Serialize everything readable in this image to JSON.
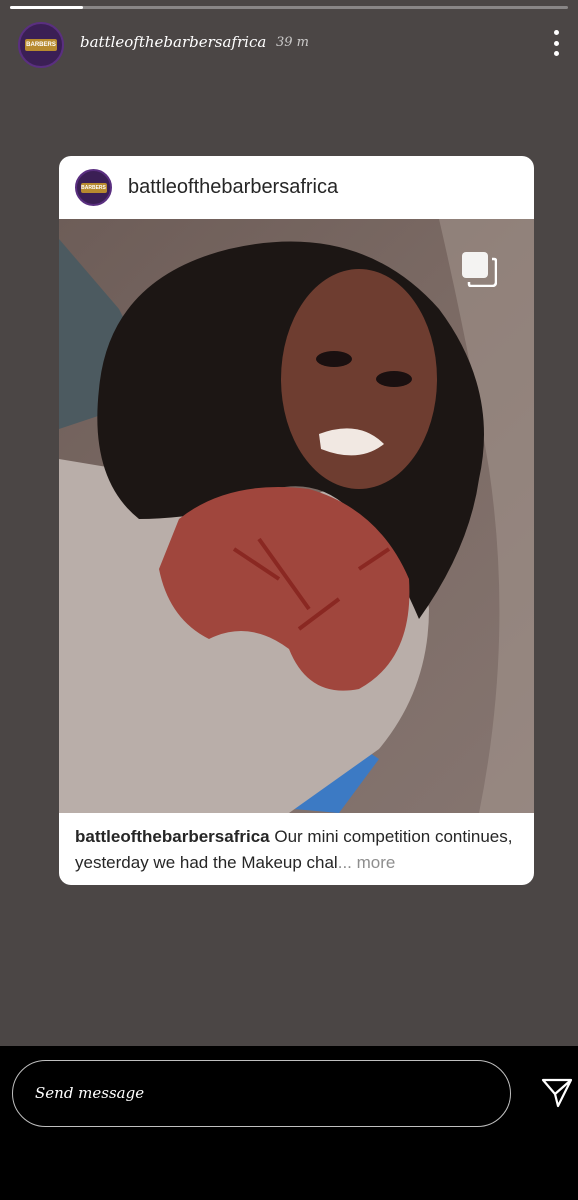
{
  "story": {
    "username": "battleofthebarbersafrica",
    "time": "39 m",
    "progress": 0.13,
    "icons": {
      "avatar": "profile-avatar",
      "menu": "more-vertical-icon"
    }
  },
  "post": {
    "username": "battleofthebarbersafrica",
    "caption_user": "battleofthebarbersafrica",
    "caption_text": " Our mini competition continues, yesterday we had the Makeup chal",
    "caption_ellipsis": "...",
    "caption_more": " more",
    "image": "zombie-makeup-photo",
    "icons": {
      "multi": "multiple-media-icon"
    }
  },
  "reply": {
    "placeholder": "Send message",
    "send_icon": "paper-plane-icon"
  },
  "colors": {
    "story_bg": "#4b4645",
    "card_bg": "#ffffff",
    "avatar_bg": "#3b1f55",
    "text_dark": "#262626",
    "text_muted": "#8e8e8e"
  }
}
